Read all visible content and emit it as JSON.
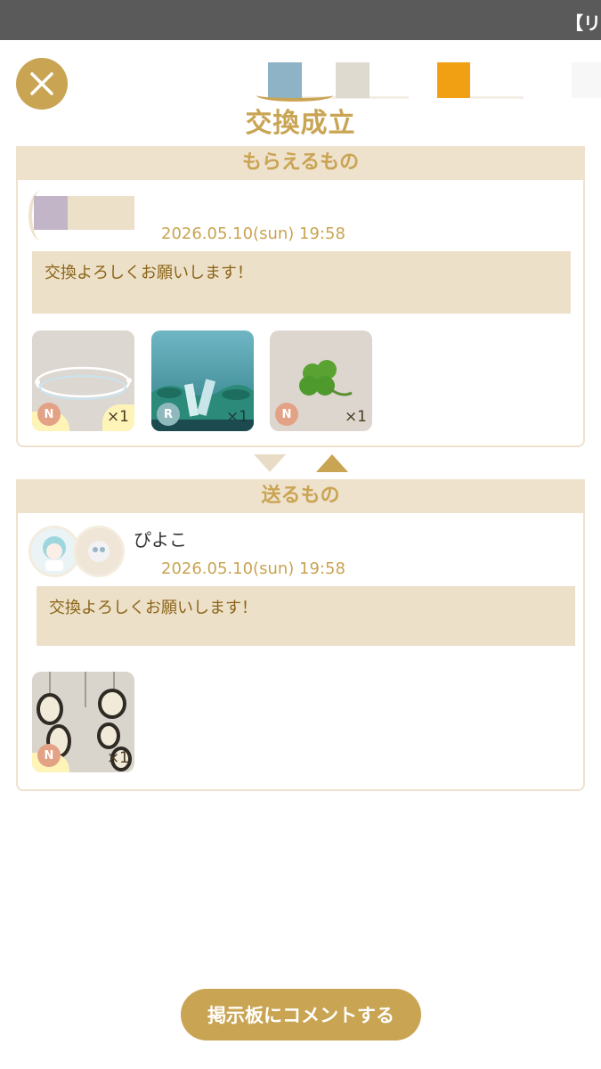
{
  "status_bar": {
    "text": "【リ"
  },
  "header": {
    "title": "交換成立"
  },
  "swatch_colors": [
    "#8fb3c6",
    "#dedad0",
    "#f0a012",
    "#f7f7f7"
  ],
  "receive": {
    "heading": "もらえるもの",
    "timestamp": "2026.05.10(sun) 19:58",
    "message": "交換よろしくお願いします！",
    "items": [
      {
        "rarity": "N",
        "qty": "×1",
        "icon": "ring-halo-icon"
      },
      {
        "rarity": "R",
        "qty": "×1",
        "icon": "underwater-scene-icon"
      },
      {
        "rarity": "N",
        "qty": "×1",
        "icon": "clover-icon"
      }
    ]
  },
  "send": {
    "heading": "送るもの",
    "sender_name": "ぴよこ",
    "timestamp": "2026.05.10(sun) 19:58",
    "message": "交換よろしくお願いします！",
    "items": [
      {
        "rarity": "N",
        "qty": "×1",
        "icon": "melting-clocks-icon"
      }
    ]
  },
  "footer": {
    "comment_button": "掲示板にコメントする"
  },
  "colors": {
    "accent": "#c9a453",
    "panel_header": "#efe2cd",
    "message_bg": "#ede0c8"
  }
}
